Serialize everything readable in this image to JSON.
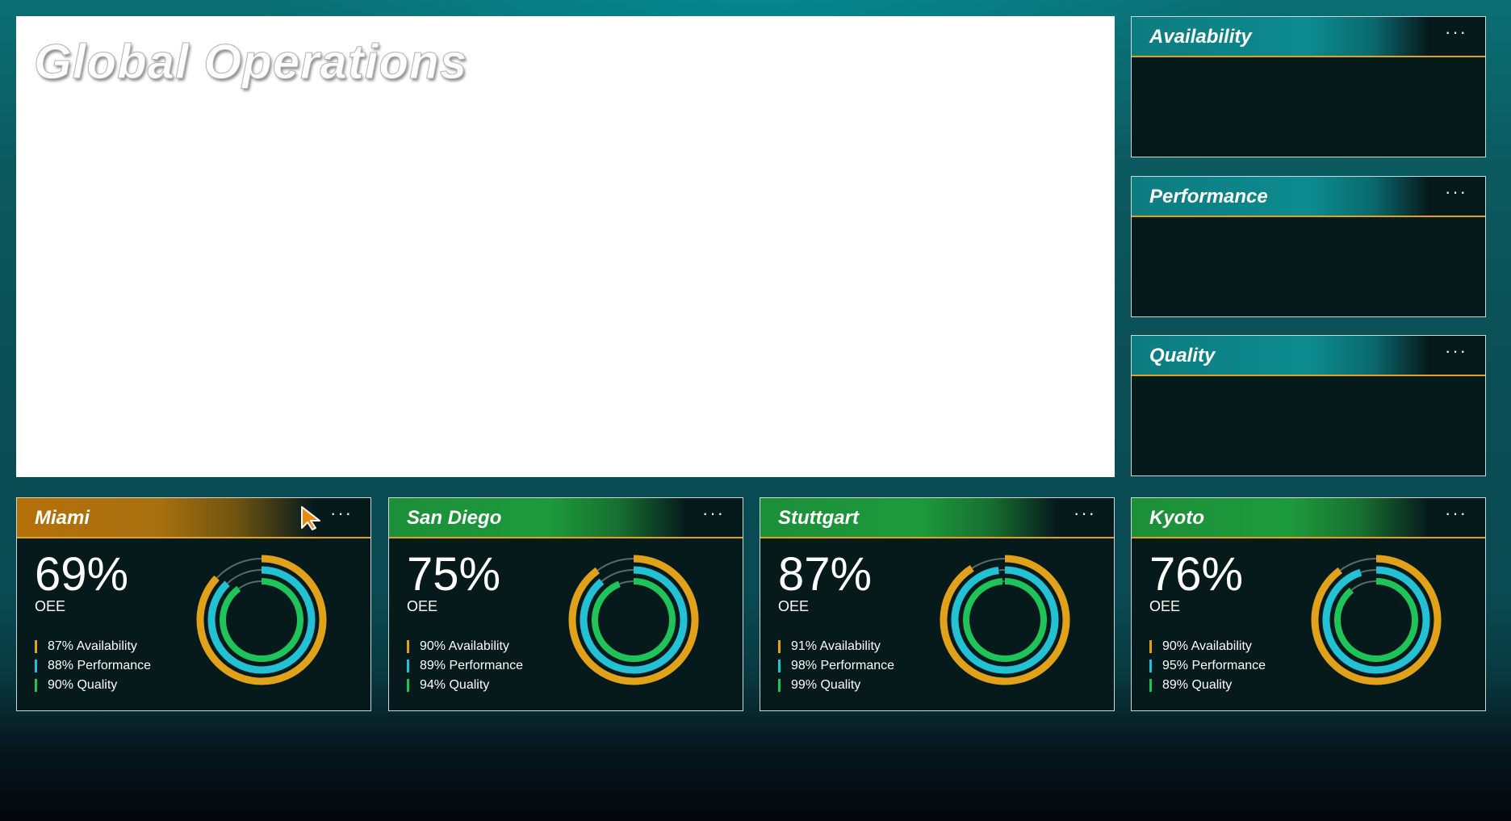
{
  "map": {
    "title": "Global Operations"
  },
  "metrics": [
    {
      "title": "Availability",
      "menu": "···"
    },
    {
      "title": "Performance",
      "menu": "···"
    },
    {
      "title": "Quality",
      "menu": "···"
    }
  ],
  "colors": {
    "availability": "#e1a21a",
    "performance": "#22c2d4",
    "quality": "#1ec45a",
    "accent_line": "#e1a21a"
  },
  "sites": [
    {
      "name": "Miami",
      "oee": "69%",
      "oee_label": "OEE",
      "availability": 87,
      "performance": 88,
      "quality": 90,
      "availability_text": "87% Availability",
      "performance_text": "88% Performance",
      "quality_text": "90% Quality",
      "menu": "···"
    },
    {
      "name": "San Diego",
      "oee": "75%",
      "oee_label": "OEE",
      "availability": 90,
      "performance": 89,
      "quality": 94,
      "availability_text": "90% Availability",
      "performance_text": "89% Performance",
      "quality_text": "94% Quality",
      "menu": "···"
    },
    {
      "name": "Stuttgart",
      "oee": "87%",
      "oee_label": "OEE",
      "availability": 91,
      "performance": 98,
      "quality": 99,
      "availability_text": "91% Availability",
      "performance_text": "98% Performance",
      "quality_text": "99% Quality",
      "menu": "···"
    },
    {
      "name": "Kyoto",
      "oee": "76%",
      "oee_label": "OEE",
      "availability": 90,
      "performance": 95,
      "quality": 89,
      "availability_text": "90% Availability",
      "performance_text": "95% Performance",
      "quality_text": "89% Quality",
      "menu": "···"
    }
  ]
}
